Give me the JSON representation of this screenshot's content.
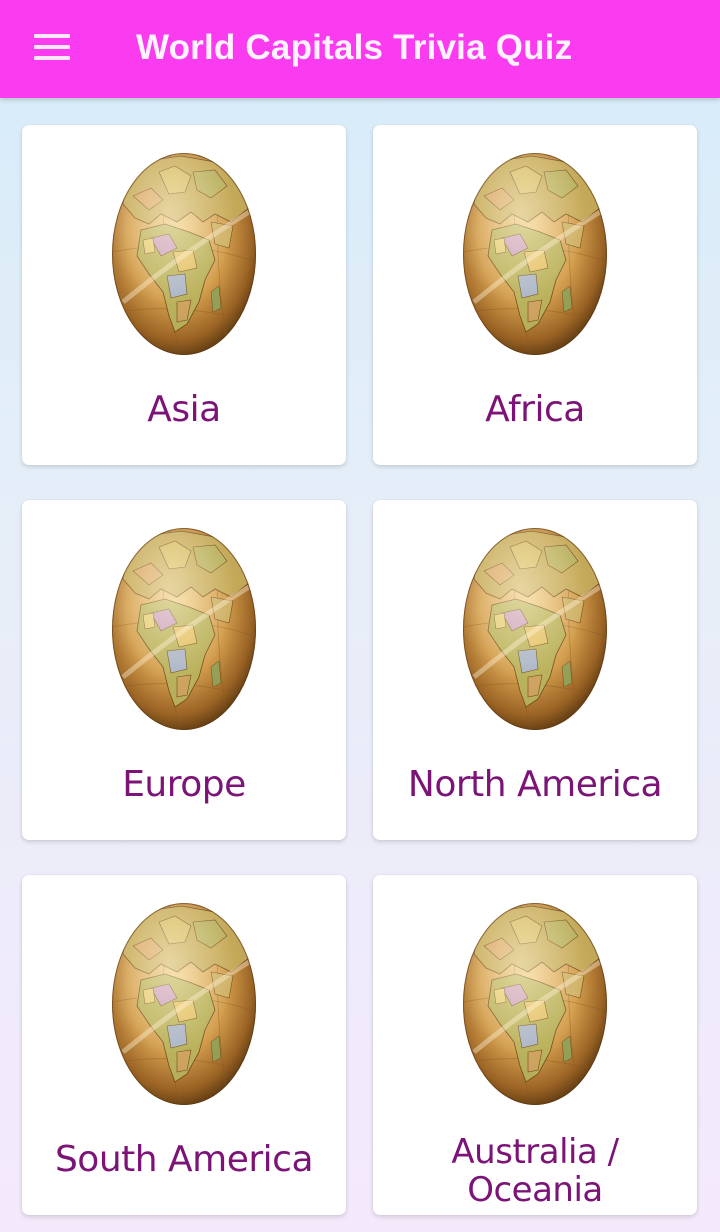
{
  "app_bar": {
    "title": "World Capitals Trivia Quiz",
    "background": "#fa3bf0",
    "menu_icon": "hamburger-menu-icon"
  },
  "categories": [
    {
      "label": "Asia",
      "image": "globe-icon"
    },
    {
      "label": "Africa",
      "image": "globe-icon"
    },
    {
      "label": "Europe",
      "image": "globe-icon"
    },
    {
      "label": "North America",
      "image": "globe-icon"
    },
    {
      "label": "South America",
      "image": "globe-icon"
    },
    {
      "label": "Australia / Oceania",
      "image": "globe-icon"
    }
  ],
  "colors": {
    "label_text": "#7c1478",
    "card_background": "#ffffff"
  }
}
